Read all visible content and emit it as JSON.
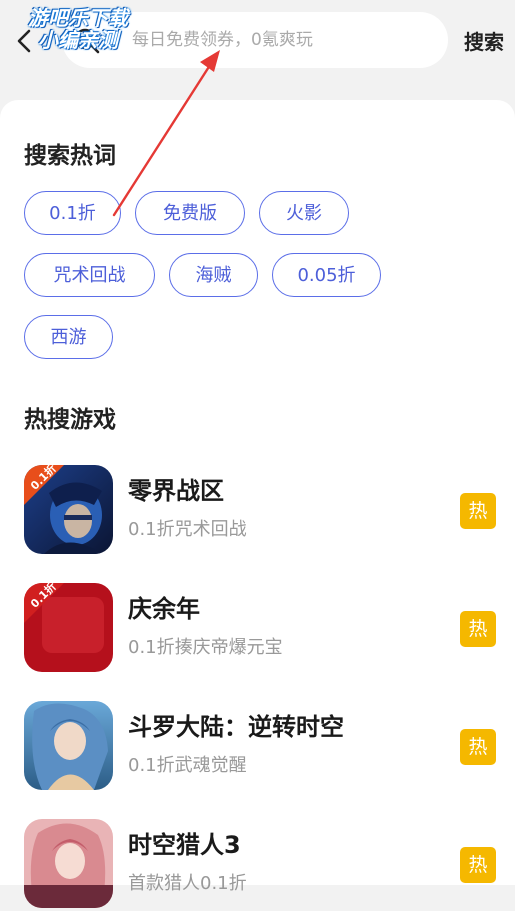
{
  "header": {
    "search_placeholder": "每日免费领券，0氪爽玩",
    "search_button": "搜索"
  },
  "watermark": {
    "line1": "游吧乐下载",
    "line2": "小编亲测"
  },
  "hot_words": {
    "title": "搜索热词",
    "chips": [
      "0.1折",
      "免费版",
      "火影",
      "咒术回战",
      "海贼",
      "0.05折",
      "西游"
    ]
  },
  "hot_games": {
    "title": "热搜游戏",
    "badge": "热",
    "icon_tag": "0.1折",
    "items": [
      {
        "name": "零界战区",
        "desc": "0.1折咒术回战"
      },
      {
        "name": "庆余年",
        "desc": "0.1折揍庆帝爆元宝"
      },
      {
        "name": "斗罗大陆：逆转时空",
        "desc": "0.1折武魂觉醒"
      },
      {
        "name": "时空猎人3",
        "desc": "首款猎人0.1折"
      }
    ]
  },
  "colors": {
    "accent": "#5b6ee8",
    "hot_badge": "#f5b800",
    "annotation": "#e53935"
  }
}
